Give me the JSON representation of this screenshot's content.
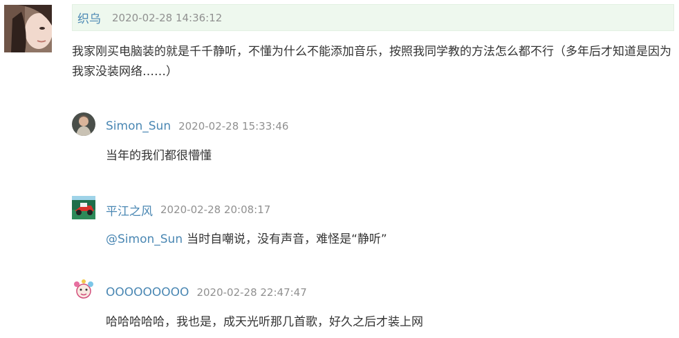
{
  "main_comment": {
    "author": "织乌",
    "timestamp": "2020-02-28 14:36:12",
    "text": "我家刚买电脑装的就是千千静听，不懂为什么不能添加音乐，按照我同学教的方法怎么都不行（多年后才知道是因为我家没装网络……）"
  },
  "replies": [
    {
      "author": "Simon_Sun",
      "timestamp": "2020-02-28 15:33:46",
      "mention": "",
      "text": "当年的我们都很懵懂"
    },
    {
      "author": "平江之风",
      "timestamp": "2020-02-28 20:08:17",
      "mention": "@Simon_Sun",
      "text": "当时自嘲说，没有声音，难怪是“静听”"
    },
    {
      "author": "OOOOOOOOO",
      "timestamp": "2020-02-28 22:47:47",
      "mention": "",
      "text": "哈哈哈哈哈，我也是，成天光听那几首歌，好久之后才装上网"
    }
  ]
}
